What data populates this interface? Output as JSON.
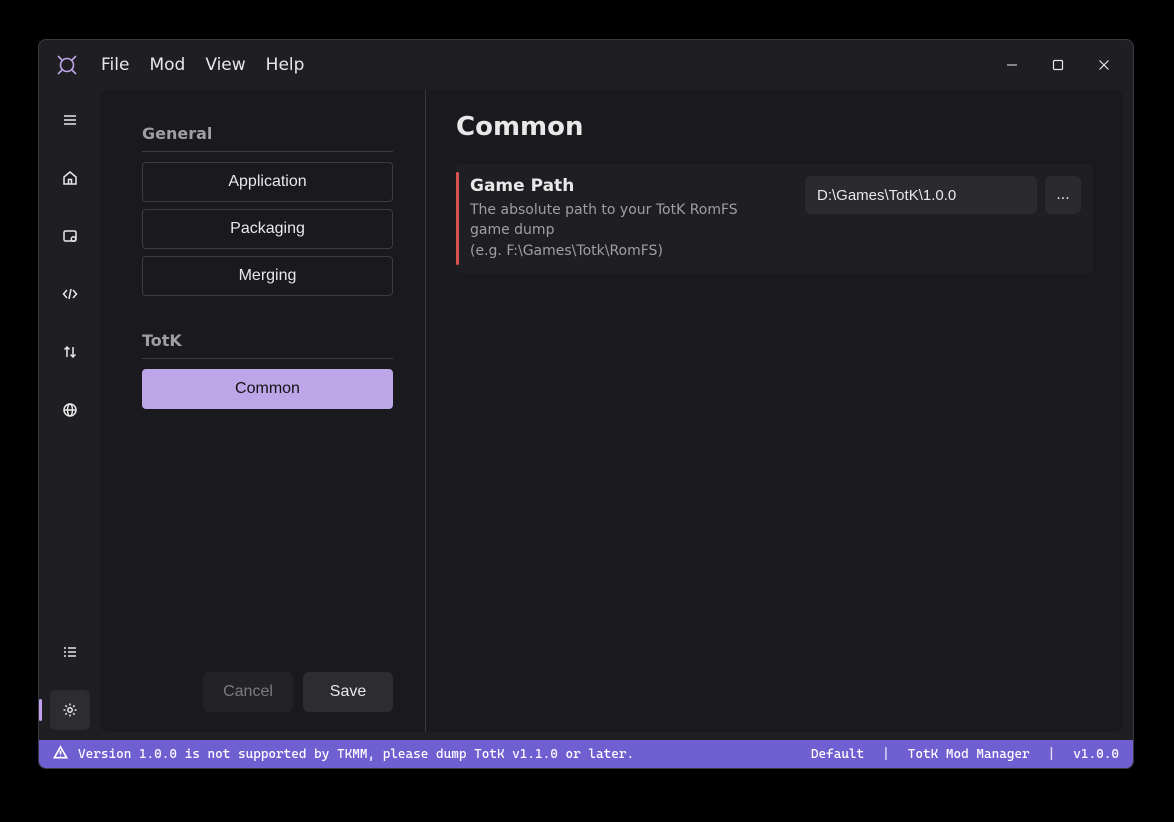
{
  "menubar": {
    "items": [
      "File",
      "Mod",
      "View",
      "Help"
    ]
  },
  "rail": {
    "icons": [
      "menu",
      "home",
      "package",
      "code",
      "updown",
      "globe"
    ],
    "bottom_icons": [
      "list",
      "settings"
    ],
    "active": "settings"
  },
  "settings": {
    "groups": [
      {
        "title": "General",
        "items": [
          "Application",
          "Packaging",
          "Merging"
        ]
      },
      {
        "title": "TotK",
        "items": [
          "Common"
        ]
      }
    ],
    "selected": "Common",
    "actions": {
      "cancel": "Cancel",
      "save": "Save"
    }
  },
  "content": {
    "heading": "Common",
    "game_path": {
      "title": "Game Path",
      "desc_line1": "The absolute path to your TotK RomFS game dump",
      "desc_line2": "(e.g. F:\\Games\\Totk\\RomFS)",
      "value": "D:\\Games\\TotK\\1.0.0",
      "browse_label": "..."
    }
  },
  "statusbar": {
    "message": "Version 1.0.0 is not supported by TKMM, please dump TotK v1.1.0 or later.",
    "profile": "Default",
    "app_name": "TotK Mod Manager",
    "version": "v1.0.0"
  }
}
